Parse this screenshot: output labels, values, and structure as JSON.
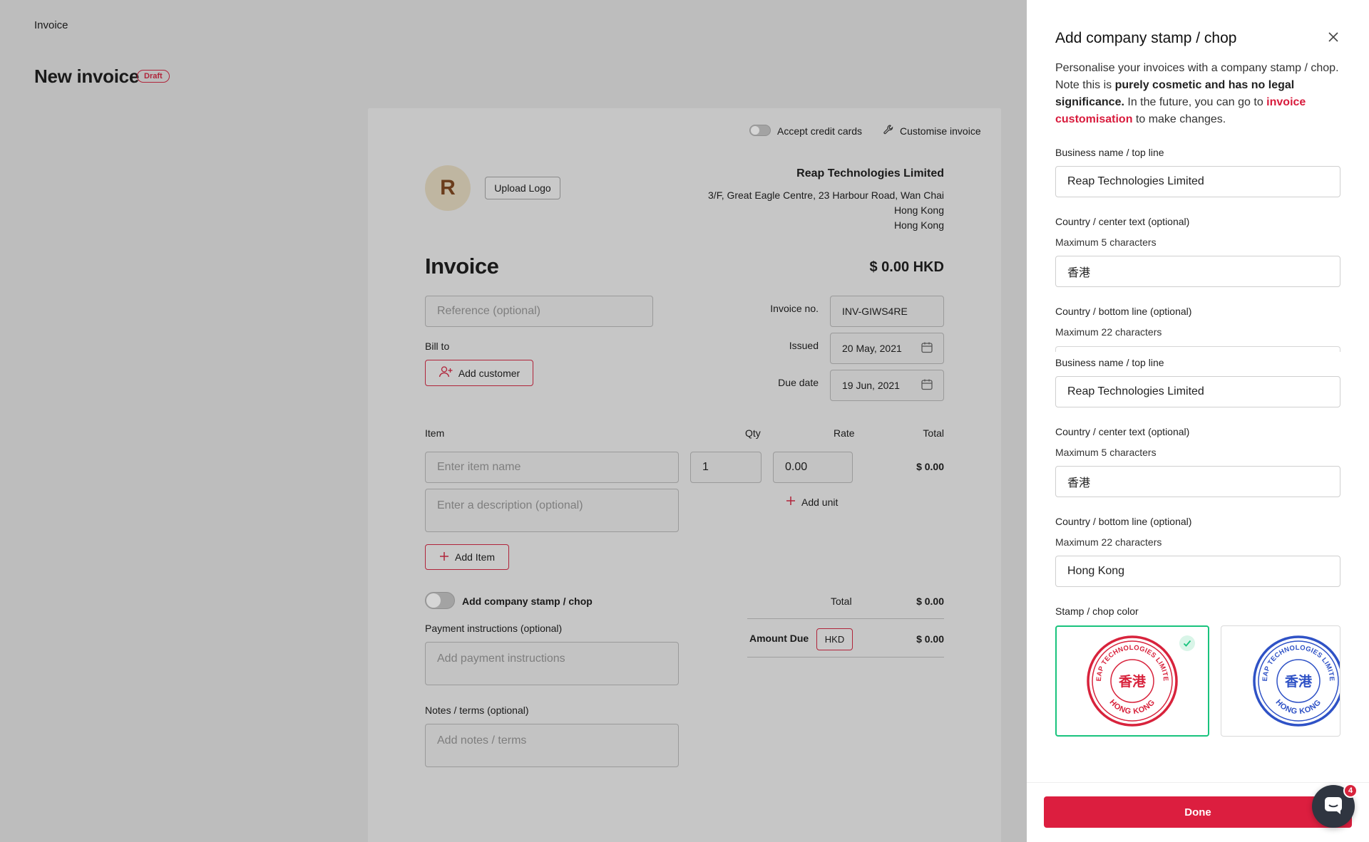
{
  "breadcrumb": "Invoice",
  "page": {
    "title": "New invoice",
    "status": "Draft"
  },
  "card": {
    "accept_cards_label": "Accept credit cards",
    "customise_label": "Customise invoice",
    "avatar_letter": "R",
    "upload_logo": "Upload Logo",
    "company": {
      "name": "Reap Technologies Limited",
      "address1": "3/F, Great Eagle Centre, 23 Harbour Road, Wan Chai",
      "address2": "Hong Kong",
      "address3": "Hong Kong"
    },
    "invoice_heading": "Invoice",
    "amount_header": "$ 0.00 HKD",
    "reference_placeholder": "Reference (optional)",
    "invoice_no_label": "Invoice no.",
    "invoice_no": "INV-GIWS4RE",
    "issued_label": "Issued",
    "issued": "20 May, 2021",
    "due_label": "Due date",
    "due": "19 Jun, 2021",
    "bill_to": "Bill to",
    "add_customer": "Add customer",
    "items": {
      "col_item": "Item",
      "col_qty": "Qty",
      "col_rate": "Rate",
      "col_total": "Total",
      "item_placeholder": "Enter item name",
      "qty": "1",
      "rate": "0.00",
      "row_total": "$ 0.00",
      "desc_placeholder": "Enter a description (optional)",
      "add_unit": "Add unit",
      "add_item": "Add Item"
    },
    "stamp_toggle_label": "Add company stamp / chop",
    "total_label": "Total",
    "total_value": "$ 0.00",
    "amount_due_label": "Amount Due",
    "currency": "HKD",
    "amount_due_value": "$ 0.00",
    "payment_label": "Payment instructions (optional)",
    "payment_placeholder": "Add payment instructions",
    "notes_label": "Notes / terms (optional)",
    "notes_placeholder": "Add notes / terms"
  },
  "drawer": {
    "title": "Add company stamp / chop",
    "intro_1": "Personalise your invoices with a company stamp / chop. Note this is ",
    "intro_bold": "purely cosmetic and has no legal significance.",
    "intro_2": " In the future, you can go to ",
    "intro_link": "invoice customisation",
    "intro_3": " to make changes.",
    "business_label": "Business name / top line",
    "business_value": "Reap Technologies Limited",
    "center_label": "Country / center text (optional)",
    "center_hint": "Maximum 5 characters",
    "center_value": "香港",
    "bottom_label": "Country / bottom line (optional)",
    "bottom_hint": "Maximum 22 characters",
    "business_label_2": "Business name / top line",
    "business_value_2": "Reap Technologies Limited",
    "center_label_2": "Country / center text (optional)",
    "center_hint_2": "Maximum 5 characters",
    "center_value_2": "香港",
    "bottom_label_2": "Country / bottom line (optional)",
    "bottom_hint_2": "Maximum 22 characters",
    "bottom_value_2": "Hong Kong",
    "color_label": "Stamp / chop color",
    "stamps": [
      {
        "color": "#d8233c",
        "top": "REAP TECHNOLOGIES LIMITED",
        "center": "香港",
        "bottom": "HONG KONG",
        "selected": true
      },
      {
        "color": "#2f52c6",
        "top": "REAP TECHNOLOGIES LIMITED",
        "center": "香港",
        "bottom": "HONG KONG",
        "selected": false
      }
    ],
    "done": "Done"
  },
  "chat": {
    "badge": "4"
  }
}
